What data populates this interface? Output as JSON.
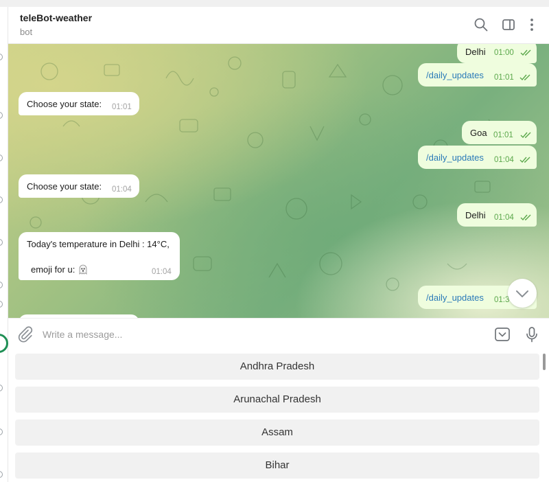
{
  "header": {
    "title": "teleBot-weather",
    "subtitle": "bot"
  },
  "messages": [
    {
      "dir": "out",
      "text": "Delhi",
      "time": "01:00"
    },
    {
      "dir": "out",
      "text": "/daily_updates",
      "time": "01:01",
      "command": true
    },
    {
      "dir": "in",
      "text": "Choose your state:",
      "time": "01:01"
    },
    {
      "dir": "out",
      "text": "Goa",
      "time": "01:01"
    },
    {
      "dir": "out",
      "text": "/daily_updates",
      "time": "01:04",
      "command": true
    },
    {
      "dir": "in",
      "text": "Choose your state:",
      "time": "01:04"
    },
    {
      "dir": "out",
      "text": "Delhi",
      "time": "01:04"
    },
    {
      "dir": "in",
      "text": "Today's temperature in Delhi : 14°C,",
      "text2": "emoji for u:",
      "time": "01:04"
    },
    {
      "dir": "out",
      "text": "/daily_updates",
      "time": "01:3",
      "command": true
    }
  ],
  "composer": {
    "placeholder": "Write a message..."
  },
  "keyboard": {
    "buttons": [
      "Andhra Pradesh",
      "Arunachal Pradesh",
      "Assam",
      "Bihar"
    ]
  },
  "colors": {
    "outgoing_bubble": "#effdde",
    "incoming_bubble": "#ffffff",
    "command_link": "#2a7ab8",
    "read_ticks": "#5aa74a"
  },
  "icons": [
    "search-icon",
    "sidebar-toggle-icon",
    "more-vertical-icon",
    "attach-icon",
    "bot-keyboard-icon",
    "microphone-icon",
    "chevron-down-icon",
    "ghost-emoji",
    "double-check-icon"
  ]
}
